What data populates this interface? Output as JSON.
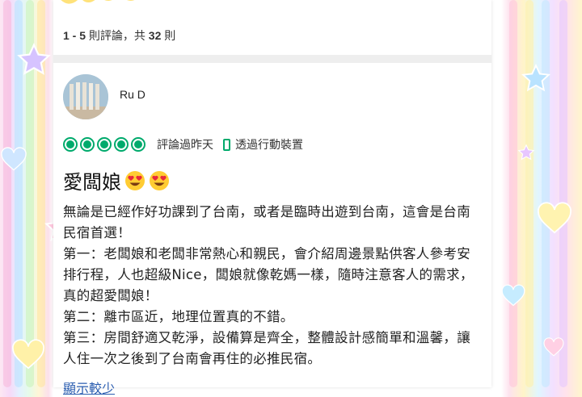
{
  "review_count": {
    "range_prefix": "1 - 5",
    "range_suffix": " 則評論，共 ",
    "total": "32",
    "total_suffix": " 則"
  },
  "review": {
    "username": "Ru D",
    "rating": 5,
    "review_date": "評論過昨天",
    "device_label": "透過行動裝置",
    "title": "愛闆娘",
    "body_lines": [
      "無論是已經作好功課到了台南，或者是臨時出遊到台南，這會是台南民宿首選！",
      "第一：老闆娘和老闆非常熱心和親民，會介紹周邊景點供客人參考安排行程，人也超級Nice，闆娘就像乾媽一樣，隨時注意客人的需求，真的超愛闆娘！",
      "第二：離市區近，地理位置真的不錯。",
      "第三：房間舒適又乾淨，設備算是齊全，整體設計感簡單和溫馨，讓人住一次之後到了台南會再住的必推民宿。"
    ],
    "show_less_label": "顯示較少"
  },
  "colors": {
    "rating_green": "#00aa6c",
    "link_blue": "#2a5db0"
  }
}
